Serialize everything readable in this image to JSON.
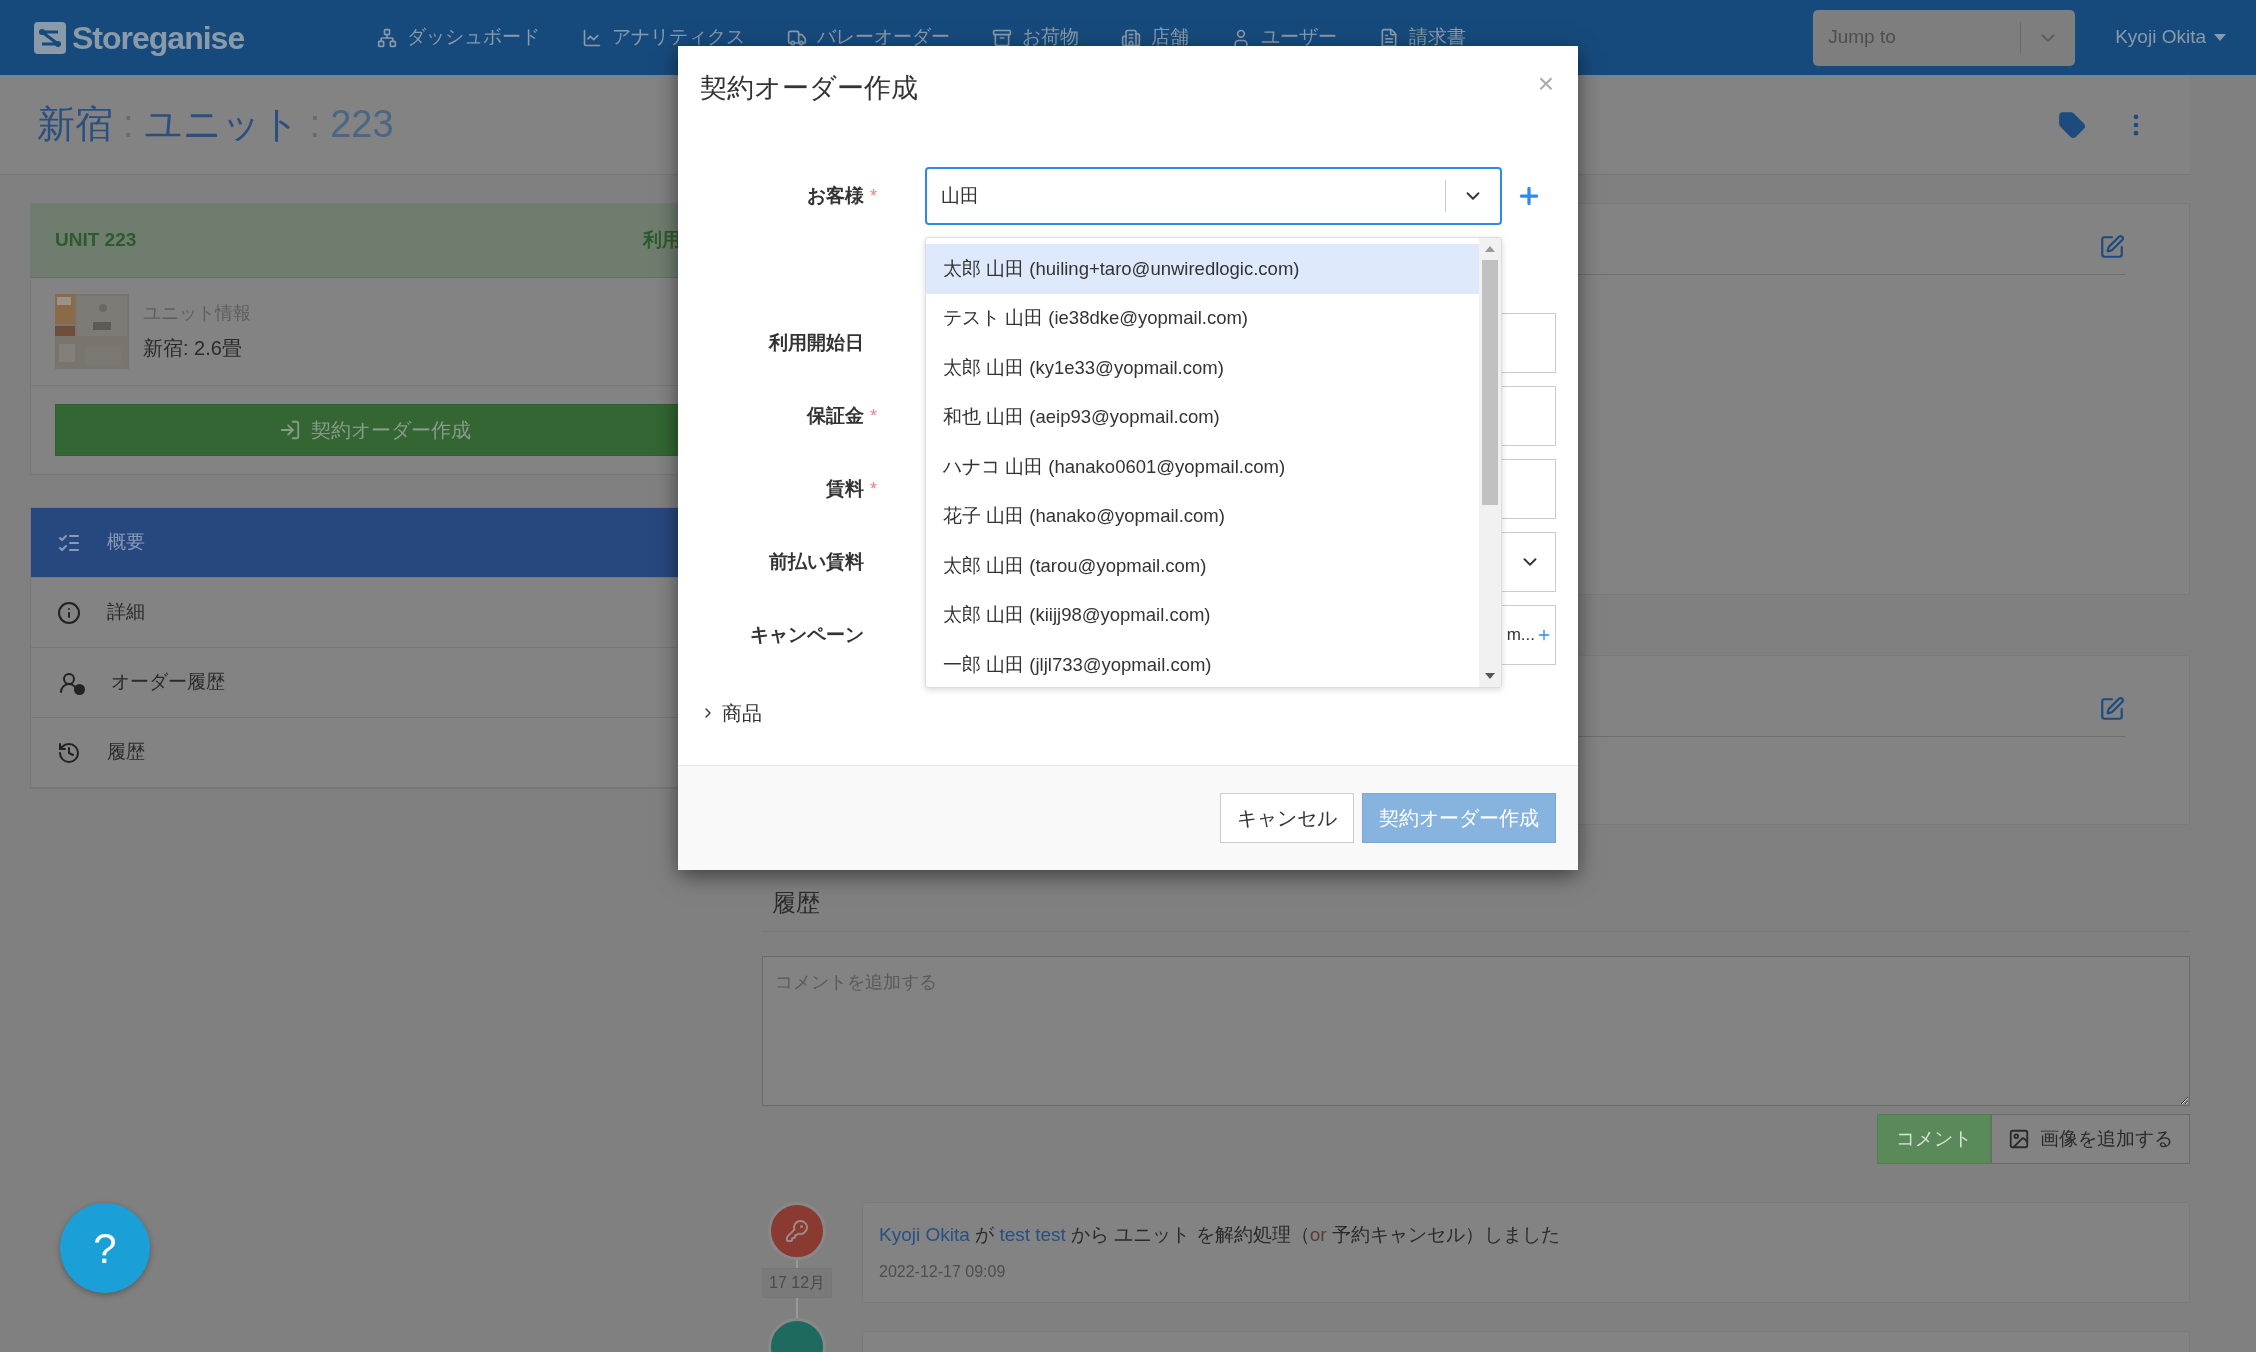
{
  "header": {
    "logo": "Storeganise",
    "nav": [
      {
        "label": "ダッシュボード",
        "kind": "sitemap"
      },
      {
        "label": "アナリティクス",
        "kind": "chart"
      },
      {
        "label": "バレーオーダー",
        "kind": "truck"
      },
      {
        "label": "お荷物",
        "kind": "box"
      },
      {
        "label": "店舗",
        "kind": "building"
      },
      {
        "label": "ユーザー",
        "kind": "user"
      },
      {
        "label": "請求書",
        "kind": "file"
      }
    ],
    "jump_to": {
      "placeholder": "Jump to"
    },
    "user": "Kyoji Okita"
  },
  "breadcrumb": [
    {
      "text": "新宿",
      "kind": "link"
    },
    {
      "text": ":",
      "kind": "separator"
    },
    {
      "text": "ユニット",
      "kind": "link"
    },
    {
      "text": ":",
      "kind": "separator"
    },
    {
      "text": "223",
      "kind": "current"
    }
  ],
  "unit_card": {
    "title": "UNIT 223",
    "status": "利用",
    "info_label": "ユニット情報",
    "info_value": "新宿: 2.6畳",
    "action": "契約オーダー作成"
  },
  "side_nav": [
    {
      "label": "概要",
      "kind": "list",
      "selected": true
    },
    {
      "label": "詳細",
      "kind": "info",
      "selected": false
    },
    {
      "label": "オーダー履歴",
      "kind": "user-clock",
      "selected": false
    },
    {
      "label": "履歴",
      "kind": "history",
      "selected": false
    }
  ],
  "history": {
    "title": "履歴",
    "comment_placeholder": "コメントを追加する",
    "comment_button": "コメント",
    "image_button": "画像を追加する",
    "events": [
      {
        "date": "17 12月",
        "time": "2022-12-17 09:09",
        "parts": [
          {
            "text": "Kyoji Okita",
            "kind": "link"
          },
          {
            "text": " が ",
            "kind": "plain"
          },
          {
            "text": "test test",
            "kind": "link"
          },
          {
            "text": " から ユニット を解約処理（",
            "kind": "plain"
          },
          {
            "text": "or",
            "kind": "muted"
          },
          {
            "text": " 予約キャンセル）しました",
            "kind": "plain"
          }
        ]
      }
    ]
  },
  "help_button": "?",
  "modal": {
    "title": "契約オーダー作成",
    "close": "×",
    "required_mark": "*",
    "fields": [
      {
        "label": "お客様",
        "required": true,
        "kind": "combo",
        "value": "山田"
      },
      {
        "label": "利用開始日",
        "required": false,
        "kind": "input"
      },
      {
        "label": "保証金",
        "required": true,
        "kind": "input"
      },
      {
        "label": "賃料",
        "required": true,
        "kind": "input"
      },
      {
        "label": "前払い賃料",
        "required": false,
        "kind": "select"
      },
      {
        "label": "キャンペーン",
        "required": false,
        "kind": "picker",
        "value": "m..."
      }
    ],
    "options": [
      {
        "label": "太郎 山田 (huiling+taro@unwiredlogic.com)",
        "selected": true
      },
      {
        "label": "テスト 山田 (ie38dke@yopmail.com)",
        "selected": false
      },
      {
        "label": "太郎 山田 (ky1e33@yopmail.com)",
        "selected": false
      },
      {
        "label": "和也 山田 (aeip93@yopmail.com)",
        "selected": false
      },
      {
        "label": "ハナコ 山田 (hanako0601@yopmail.com)",
        "selected": false
      },
      {
        "label": "花子 山田 (hanako@yopmail.com)",
        "selected": false
      },
      {
        "label": "太郎 山田 (tarou@yopmail.com)",
        "selected": false
      },
      {
        "label": "太郎 山田 (kiijj98@yopmail.com)",
        "selected": false
      },
      {
        "label": "一郎 山田 (jljl733@yopmail.com)",
        "selected": false
      }
    ],
    "section": {
      "label": "商品",
      "expanded": false
    },
    "cancel": "キャンセル",
    "submit": {
      "label": "契約オーダー作成",
      "disabled": true
    }
  }
}
